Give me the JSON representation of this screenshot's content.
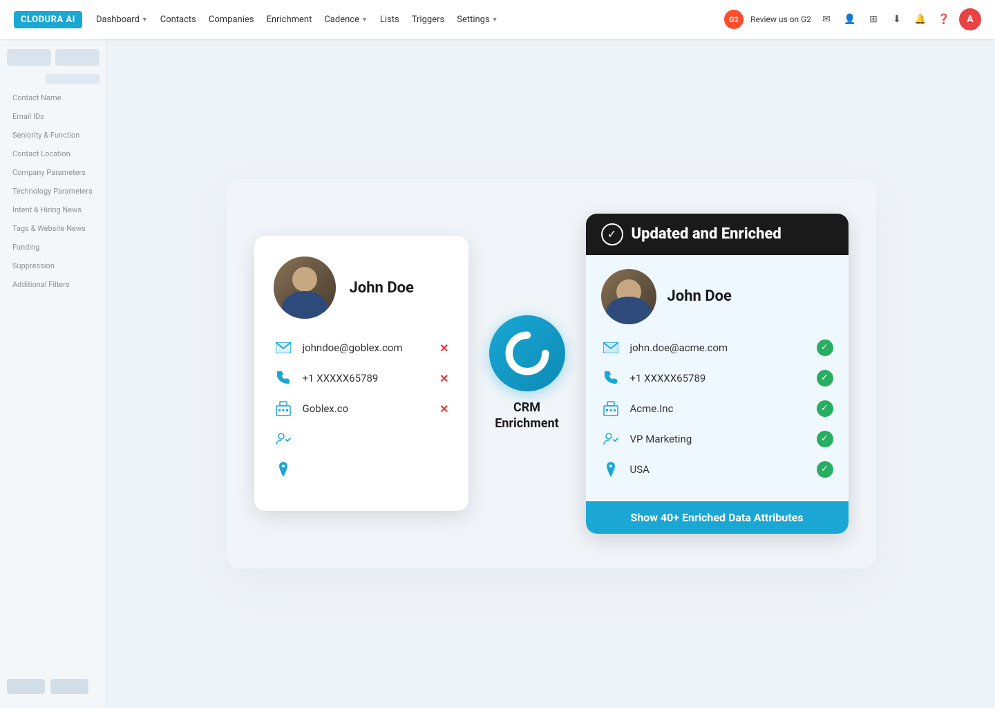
{
  "nav": {
    "logo": "CLODURA AI",
    "links": [
      "Dashboard",
      "Contacts",
      "Companies",
      "Enrichment",
      "Cadence",
      "Lists",
      "Triggers",
      "Settings"
    ],
    "dropdown_links": [
      "Dashboard",
      "Cadence",
      "Settings"
    ],
    "g2_label": "G2",
    "review_text": "Review us on G2",
    "avatar_letter": "A"
  },
  "sidebar": {
    "items": [
      "Contact Name",
      "Email IDs",
      "Seniority & Function",
      "Contact Location",
      "Company Parameters",
      "Technology Parameters",
      "Intent & Hiring News",
      "Tags & Website News",
      "Funding",
      "Suppression",
      "Additional Filters"
    ]
  },
  "card_before": {
    "name": "John Doe",
    "email": "johndoe@goblex.com",
    "phone": "+1 XXXXX65789",
    "company": "Goblex.co"
  },
  "crm": {
    "label_line1": "CRM",
    "label_line2": "Enrichment"
  },
  "card_after": {
    "header_title": "Updated and Enriched",
    "name": "John Doe",
    "email": "john.doe@acme.com",
    "phone": "+1 XXXXX65789",
    "company": "Acme.Inc",
    "title": "VP Marketing",
    "location": "USA",
    "show_more_btn": "Show 40+ Enriched Data Attributes"
  }
}
